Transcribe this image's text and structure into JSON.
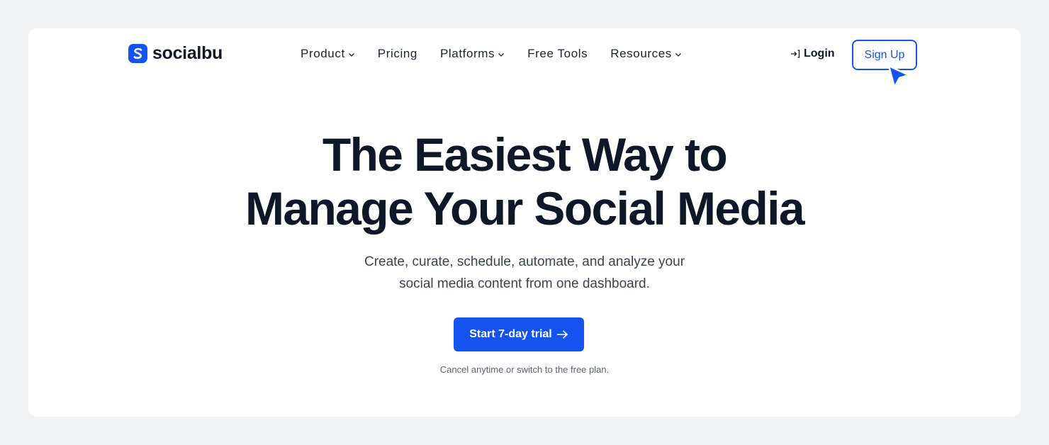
{
  "brand": {
    "name": "socialbu",
    "accent_color": "#1553f0",
    "logo_icon": "socialbu-logo-icon"
  },
  "nav": {
    "items": [
      {
        "label": "Product",
        "has_dropdown": true
      },
      {
        "label": "Pricing",
        "has_dropdown": false
      },
      {
        "label": "Platforms",
        "has_dropdown": true
      },
      {
        "label": "Free Tools",
        "has_dropdown": false
      },
      {
        "label": "Resources",
        "has_dropdown": true
      }
    ],
    "dropdown_icon": "chevron-down-icon",
    "login_label": "Login",
    "login_icon": "login-arrow-icon",
    "signup_label": "Sign Up"
  },
  "hero": {
    "title_line1": "The Easiest Way to",
    "title_line2": "Manage Your Social Media",
    "subtitle_line1": "Create, curate, schedule, automate, and analyze your",
    "subtitle_line2": "social media content from one dashboard.",
    "cta_label": "Start 7-day trial",
    "cta_icon": "arrow-right-icon",
    "note": "Cancel anytime or switch to the free plan."
  },
  "colors": {
    "page_background": "#f1f2f4",
    "card_background": "#ffffff",
    "text_dark": "#0f1729",
    "primary": "#1553f0"
  },
  "pointer": {
    "icon": "mouse-pointer-icon"
  }
}
